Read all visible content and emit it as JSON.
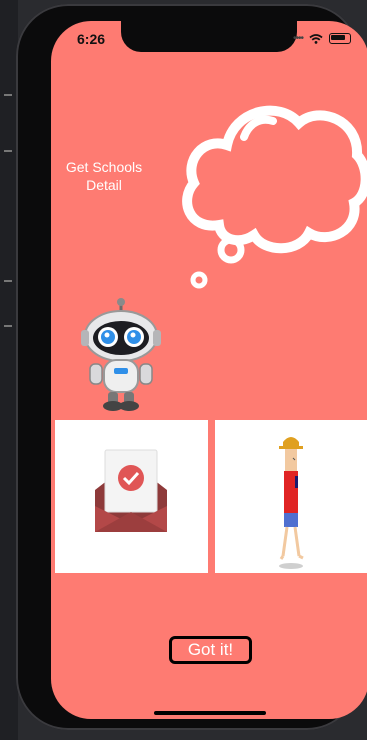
{
  "status_bar": {
    "time": "6:26"
  },
  "screen": {
    "caption": "Get Schools Detail",
    "background_color": "#fe7b72"
  },
  "cards": [
    {
      "name": "envelope-check-card",
      "icon": "envelope-check-icon"
    },
    {
      "name": "person-card",
      "icon": "walking-person-icon"
    }
  ],
  "buttons": {
    "got_it_label": "Got it!"
  },
  "icons": [
    "robot-icon",
    "thought-cloud-icon",
    "envelope-check-icon",
    "walking-person-icon"
  ]
}
